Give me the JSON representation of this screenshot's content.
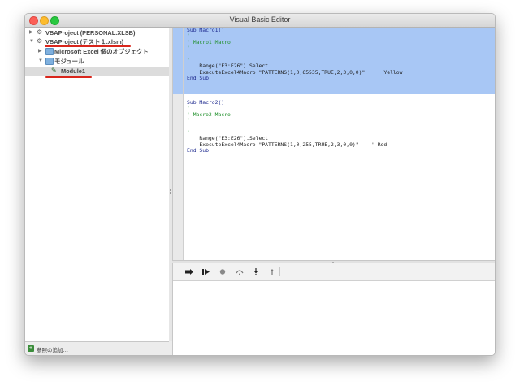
{
  "window": {
    "title": "Visual Basic Editor"
  },
  "tree": {
    "items": [
      {
        "label": "VBAProject (PERSONAL.XLSB)",
        "icon": "vbaproject-icon"
      },
      {
        "label": "VBAProject (テスト１.xlsm)",
        "icon": "vbaproject-icon"
      },
      {
        "label": "Microsoft Excel 個のオブジェクト",
        "icon": "folder-icon"
      },
      {
        "label": "モジュール",
        "icon": "folder-icon"
      },
      {
        "label": "Module1",
        "icon": "module-icon"
      }
    ]
  },
  "status": {
    "text": "参照の追加…"
  },
  "code": {
    "lines": [
      {
        "t": "Sub Macro1()"
      },
      {
        "t": "'"
      },
      {
        "t": "' Macro1 Macro"
      },
      {
        "t": "'"
      },
      {
        "t": ""
      },
      {
        "t": "'"
      },
      {
        "t": "    Range(\"E3:E26\").Select"
      },
      {
        "t": "    ExecuteExcel4Macro \"PATTERNS(1,0,65535,TRUE,2,3,0,0)\"    ' Yellow"
      },
      {
        "t": "End Sub"
      },
      {
        "t": ""
      },
      {
        "t": ""
      },
      {
        "t": ""
      },
      {
        "t": "Sub Macro2()"
      },
      {
        "t": "'"
      },
      {
        "t": "' Macro2 Macro"
      },
      {
        "t": "'"
      },
      {
        "t": ""
      },
      {
        "t": "'"
      },
      {
        "t": "    Range(\"E3:E26\").Select"
      },
      {
        "t": "    ExecuteExcel4Macro \"PATTERNS(1,0,255,TRUE,2,3,0,0)\"    ' Red"
      },
      {
        "t": "End Sub"
      }
    ]
  },
  "debug": {
    "buttons": [
      "continue-icon",
      "step-forward-icon",
      "stop-icon",
      "step-over-icon",
      "step-into-icon",
      "step-out-icon"
    ]
  },
  "colors": {
    "selection": "#a8c7f5",
    "keyword": "#1f2b8f",
    "comment": "#1f8f2a",
    "annotation": "#d9261c"
  }
}
